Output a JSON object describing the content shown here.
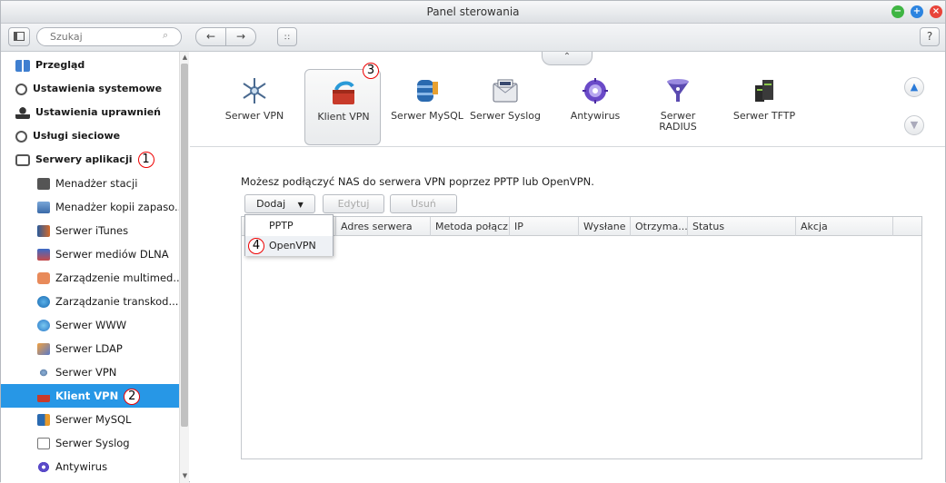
{
  "window": {
    "title": "Panel sterowania"
  },
  "toolbar": {
    "search_placeholder": "Szukaj",
    "help_label": "?"
  },
  "sidebar": {
    "items": [
      {
        "label": "Przegląd"
      },
      {
        "label": "Ustawienia systemowe"
      },
      {
        "label": "Ustawienia uprawnień"
      },
      {
        "label": "Usługi sieciowe"
      },
      {
        "label": "Serwery aplikacji",
        "badge": "1"
      },
      {
        "label": "Menadżer stacji"
      },
      {
        "label": "Menadżer kopii zapaso..."
      },
      {
        "label": "Serwer iTunes"
      },
      {
        "label": "Serwer mediów DLNA"
      },
      {
        "label": "Zarządzenie multimed..."
      },
      {
        "label": "Zarządzanie transkod..."
      },
      {
        "label": "Serwer WWW"
      },
      {
        "label": "Serwer LDAP"
      },
      {
        "label": "Serwer VPN"
      },
      {
        "label": "Klient VPN",
        "badge": "2"
      },
      {
        "label": "Serwer MySQL"
      },
      {
        "label": "Serwer Syslog"
      },
      {
        "label": "Antywirus"
      }
    ]
  },
  "apps": [
    {
      "label": "Serwer VPN",
      "icon": "vpn-server-icon"
    },
    {
      "label": "Klient VPN",
      "icon": "vpn-client-icon",
      "badge": "3"
    },
    {
      "label": "Serwer MySQL",
      "icon": "mysql-icon"
    },
    {
      "label": "Serwer Syslog",
      "icon": "syslog-icon"
    },
    {
      "label": "Antywirus",
      "icon": "antivirus-icon"
    },
    {
      "label": "Serwer RADIUS",
      "icon": "radius-icon"
    },
    {
      "label": "Serwer TFTP",
      "icon": "tftp-icon"
    }
  ],
  "main": {
    "info_text": "Możesz podłączyć NAS do serwera VPN poprzez PPTP lub OpenVPN.",
    "add_label": "Dodaj",
    "edit_label": "Edytuj",
    "delete_label": "Usuń",
    "columns": [
      "",
      "Adres serwera",
      "Metoda połącz...",
      "IP",
      "Wysłane",
      "Otrzyma...",
      "Status",
      "Akcja"
    ],
    "menu": [
      {
        "label": "PPTP"
      },
      {
        "label": "OpenVPN",
        "badge": "4"
      }
    ]
  },
  "colors": {
    "selection": "#2797e6",
    "badge_outline": "#ee0000"
  }
}
